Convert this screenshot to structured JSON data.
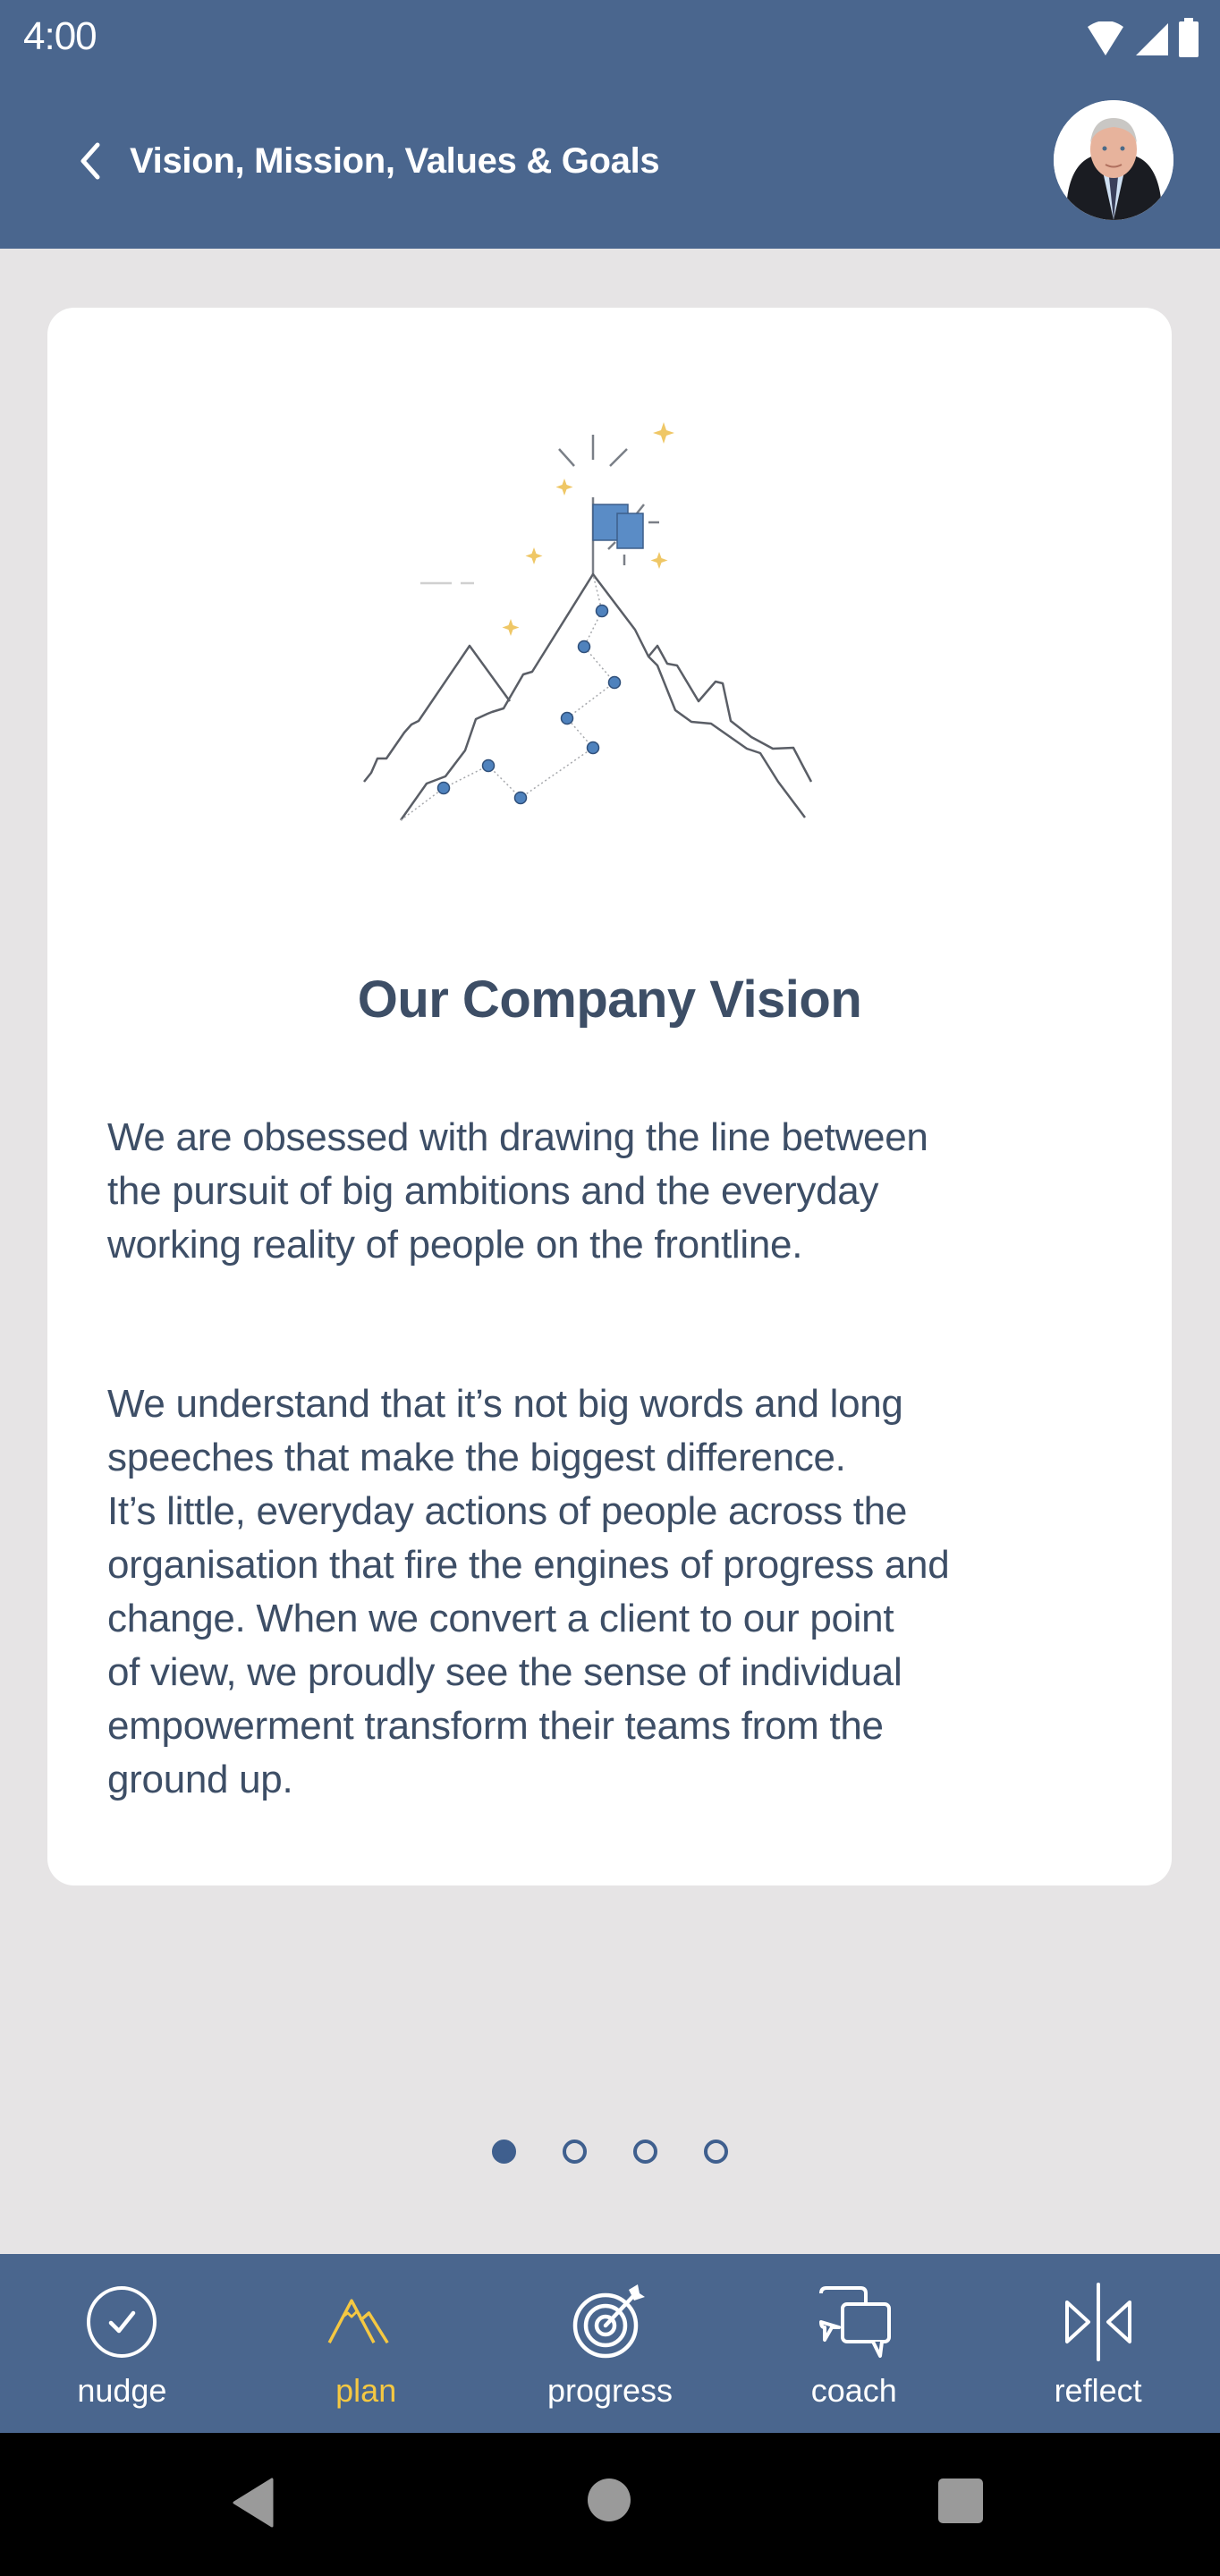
{
  "status_bar": {
    "time": "4:00",
    "icons": [
      "wifi-icon",
      "signal-icon",
      "battery-icon"
    ]
  },
  "header": {
    "back_icon": "chevron-left-icon",
    "title": "Vision, Mission, Values & Goals",
    "avatar_alt": "User profile photo"
  },
  "card": {
    "illustration": "mountain-flag-illustration",
    "title": "Our Company Vision",
    "paragraphs": [
      "We are obsessed with drawing the line between\nthe pursuit of big ambitions and the everyday\nworking reality of people on the frontline.",
      "We understand that it’s not big words and long\nspeeches that make the biggest difference.\nIt’s little, everyday actions of people across the\norganisation that fire the engines of progress and\nchange. When we convert a client to our point\nof view, we proudly see the sense of individual\nempowerment transform their teams from the\nground up."
    ]
  },
  "pager": {
    "total": 4,
    "current": 1
  },
  "tabs": [
    {
      "label": "nudge",
      "icon": "check-circle-icon",
      "active": false
    },
    {
      "label": "plan",
      "icon": "mountain-icon",
      "active": true
    },
    {
      "label": "progress",
      "icon": "target-arrow-icon",
      "active": false
    },
    {
      "label": "coach",
      "icon": "chat-bubbles-icon",
      "active": false
    },
    {
      "label": "reflect",
      "icon": "mirror-triangles-icon",
      "active": false
    }
  ],
  "colors": {
    "primary": "#4a668e",
    "accent": "#f5c842",
    "text": "#3d4e66",
    "background": "#e6e4e5"
  }
}
